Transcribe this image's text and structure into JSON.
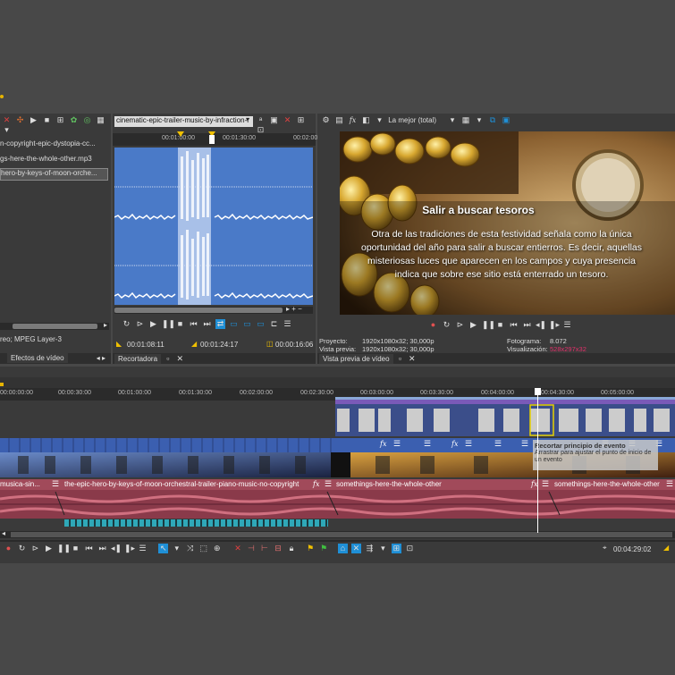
{
  "project_media": {
    "items": [
      "n-copyright-epic-dystopia-cc...",
      "gs-here-the-whole-other.mp3",
      "hero-by-keys-of-moon-orche..."
    ],
    "info": "reo; MPEG Layer-3",
    "tab_label": "Efectos de vídeo"
  },
  "trimmer": {
    "file_select": "cinematic-epic-trailer-music-by-infraction-r",
    "ruler_ticks": [
      "00:01:00:00",
      "00:01:30:00",
      "00:02:00"
    ],
    "time_in": "00:01:08:11",
    "time_out": "00:01:24:17",
    "time_len": "00:00:16:06",
    "tab_label": "Recortadora"
  },
  "preview": {
    "quality": "La mejor (total)",
    "title": "Salir a buscar tesoros",
    "body": "Otra de las tradiciones de esta festividad señala como la única oportunidad del año para salir a buscar entierros. Es decir, aquellas misteriosas luces que aparecen en los campos y cuya presencia indica que sobre ese sitio está enterrado un tesoro.",
    "info": {
      "proyecto_label": "Proyecto:",
      "proyecto_value": "1920x1080x32; 30,000p",
      "vista_label": "Vista previa:",
      "vista_value": "1920x1080x32; 30,000p",
      "fotograma_label": "Fotograma:",
      "fotograma_value": "8.072",
      "visualizacion_label": "Visualización:",
      "visualizacion_value": "528x297x32"
    },
    "tab_label": "Vista previa de vídeo"
  },
  "timeline": {
    "ruler_ticks": [
      "00:00:00:00",
      "00:00:30:00",
      "00:01:00:00",
      "00:01:30:00",
      "00:02:00:00",
      "00:02:30:00",
      "00:03:00:00",
      "00:03:30:00",
      "00:04:00:00",
      "00:04:30:00",
      "00:05:00:00"
    ],
    "audio_clips": [
      "musica-sin...",
      "the-epic-hero-by-keys-of-moon-orchestral-trailer-piano-music-no-copyright",
      "somethings-here-the-whole-other",
      "somethings-here-the-whole-other"
    ],
    "tooltip_title": "Recortar principio de evento",
    "tooltip_body": "Arrastrar para ajustar el punto de inicio de un evento",
    "timecode": "00:04:29:02"
  },
  "colors": {
    "accent": "#1f8fd6",
    "audio_track": "#8a3a4a",
    "video_track": "#3b5fb0",
    "visualizacion": "#e0306a"
  }
}
